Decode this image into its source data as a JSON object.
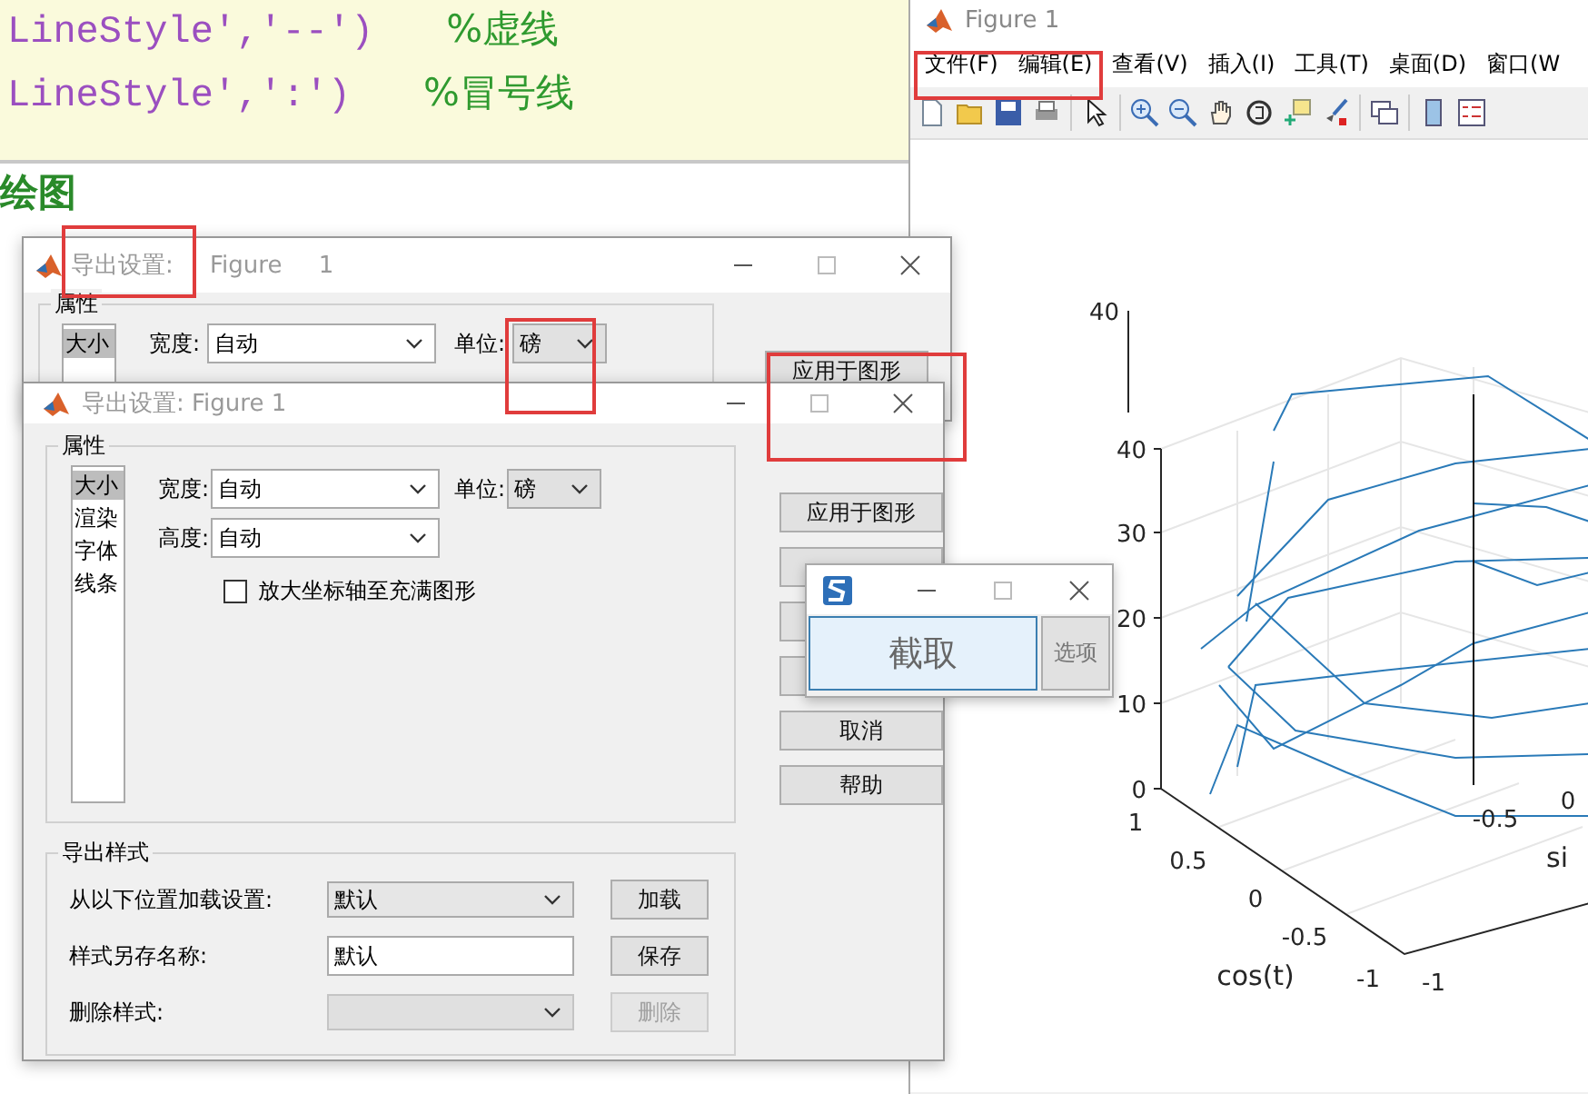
{
  "editor": {
    "code_lines": [
      {
        "code": "LineStyle','--')",
        "comment": "%虚线"
      },
      {
        "code": "LineStyle',':')",
        "comment": "%冒号线"
      }
    ],
    "heading": "绘图"
  },
  "figure_window": {
    "title": "Figure 1",
    "menu": [
      "文件(F)",
      "编辑(E)",
      "查看(V)",
      "插入(I)",
      "工具(T)",
      "桌面(D)",
      "窗口(W"
    ],
    "plot": {
      "upper_z_tick": "40",
      "z_ticks": [
        "40",
        "30",
        "20",
        "10",
        "0"
      ],
      "cos_ticks": [
        "1",
        "0.5",
        "0",
        "-0.5",
        "-1"
      ],
      "cos_label": "cos(t)",
      "sin_ticks": [
        "-1",
        "-0.5",
        "0"
      ],
      "sin_label": "si"
    }
  },
  "back_dialog": {
    "title": "导出设置: Figure 1",
    "group": "属性",
    "list": [
      {
        "label": "大小",
        "selected": true
      }
    ],
    "width_label": "宽度:",
    "width_value": "自动",
    "unit_label": "单位:",
    "unit_value": "磅",
    "button": "应用于图形"
  },
  "dialog": {
    "title": "导出设置: Figure 1",
    "properties": {
      "title": "属性",
      "list": [
        {
          "label": "大小",
          "selected": true
        },
        {
          "label": "渲染",
          "selected": false
        },
        {
          "label": "字体",
          "selected": false
        },
        {
          "label": "线条",
          "selected": false
        }
      ],
      "fields": [
        {
          "label": "宽度:",
          "value": "自动"
        },
        {
          "label": "高度:",
          "value": "自动"
        }
      ],
      "unit": {
        "label": "单位:",
        "value": "磅"
      },
      "checkbox": {
        "label": "放大坐标轴至充满图形",
        "checked": false
      }
    },
    "top_buttons": [
      "应用于图形"
    ],
    "bottom_buttons": [
      "取消",
      "帮助"
    ],
    "style": {
      "title": "导出样式",
      "rows": [
        {
          "kind": "dropdown",
          "label": "从以下位置加载设置:",
          "value": "默认",
          "button": "加载",
          "disabled": false
        },
        {
          "kind": "text",
          "label": "样式另存名称:",
          "value": "默认",
          "button": "保存",
          "disabled": false
        },
        {
          "kind": "dropdown",
          "label": "删除样式:",
          "button": "删除",
          "disabled": true
        }
      ]
    }
  },
  "snipping_tool": {
    "new_button": "截取",
    "options_button": "选项"
  }
}
